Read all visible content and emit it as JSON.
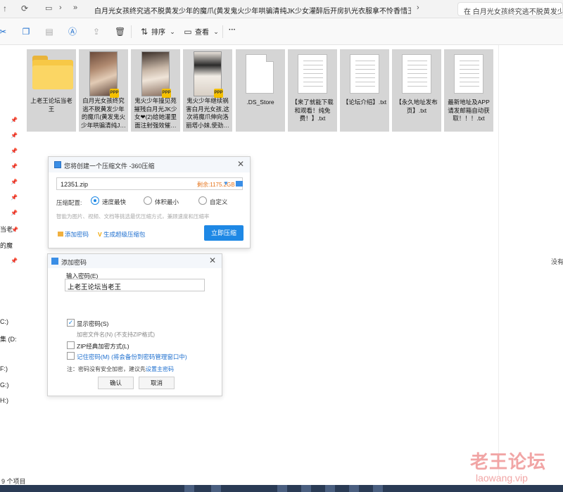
{
  "address_bar": {
    "path_chevron": "»",
    "path_segment": "白月光女孩终究逃不脱黄发少年的魔爪(黄发鬼火少年哄骗清纯JK少女灌醉后开房扒光衣服拿不怜香惜玉",
    "search_text": "在 白月光女孩终究逃不脱黄发少年"
  },
  "toolbar": {
    "sort_label": "排序",
    "view_label": "查看",
    "more_label": "···"
  },
  "files": [
    {
      "type": "folder",
      "name": "上老王论坛当老王"
    },
    {
      "type": "video",
      "name": "白月光女孩终究逃不脱黄发少年的魔爪(黄发鬼火少年哄骗清纯J…"
    },
    {
      "type": "video",
      "name": "鬼火少年撞见苑摧残白月光JK少女❤(2)给她灌里面注射强效催…"
    },
    {
      "type": "video",
      "name": "鬼火少年继续祸害白月光女孩,这次将魔爪伸向洛丽塔小妹,使劲…"
    },
    {
      "type": "file",
      "name": ".DS_Store"
    },
    {
      "type": "text",
      "name": "【来了就能下载和观看！纯免费！】.txt"
    },
    {
      "type": "text",
      "name": "【论坛介绍】.txt"
    },
    {
      "type": "text",
      "name": "【永久地址发布页】.txt"
    },
    {
      "type": "text",
      "name": "最新地址及APP请发邮箱自动获取！！！.txt"
    }
  ],
  "left_nav": {
    "fragments": [
      "当老",
      "的魔",
      "C:)",
      "集 (D:",
      "F:)",
      "G:)",
      "H:)"
    ]
  },
  "right_pane": {
    "text": "没有"
  },
  "dialog_360": {
    "title": "您将创建一个压缩文件 -360压缩",
    "filename": "12351.zip",
    "free_space": "剩余:1175.2GB",
    "config_label": "压缩配置:",
    "options": [
      "速度最快",
      "体积最小",
      "自定义"
    ],
    "selected_option": "速度最快",
    "hint": "智能为图片、视频、文档等挑选最优压缩方式，兼顾速度和压缩率",
    "add_password": "添加密码",
    "super_compress": "生成超级压缩包",
    "compress_button": "立即压缩"
  },
  "dialog_password": {
    "title": "添加密码",
    "input_label": "输入密码(E)",
    "password_value": "上老王论坛当老王",
    "show_password": "显示密码(S)",
    "show_password_checked": true,
    "encrypt_filename": "加密文件名(N) (不支持ZIP格式)",
    "zip_classic": "ZIP经典加密方式(L)",
    "remember_password": "记住密码(M) (将会备份到密码管理窗口中)",
    "note_prefix": "注：密码没有安全加密，建议先",
    "note_link": "设置主密码",
    "ok_button": "确认",
    "cancel_button": "取消"
  },
  "status_bar": {
    "item_count": "9 个项目"
  },
  "watermark": {
    "cn": "老王论坛",
    "en": "laowang.vip"
  }
}
